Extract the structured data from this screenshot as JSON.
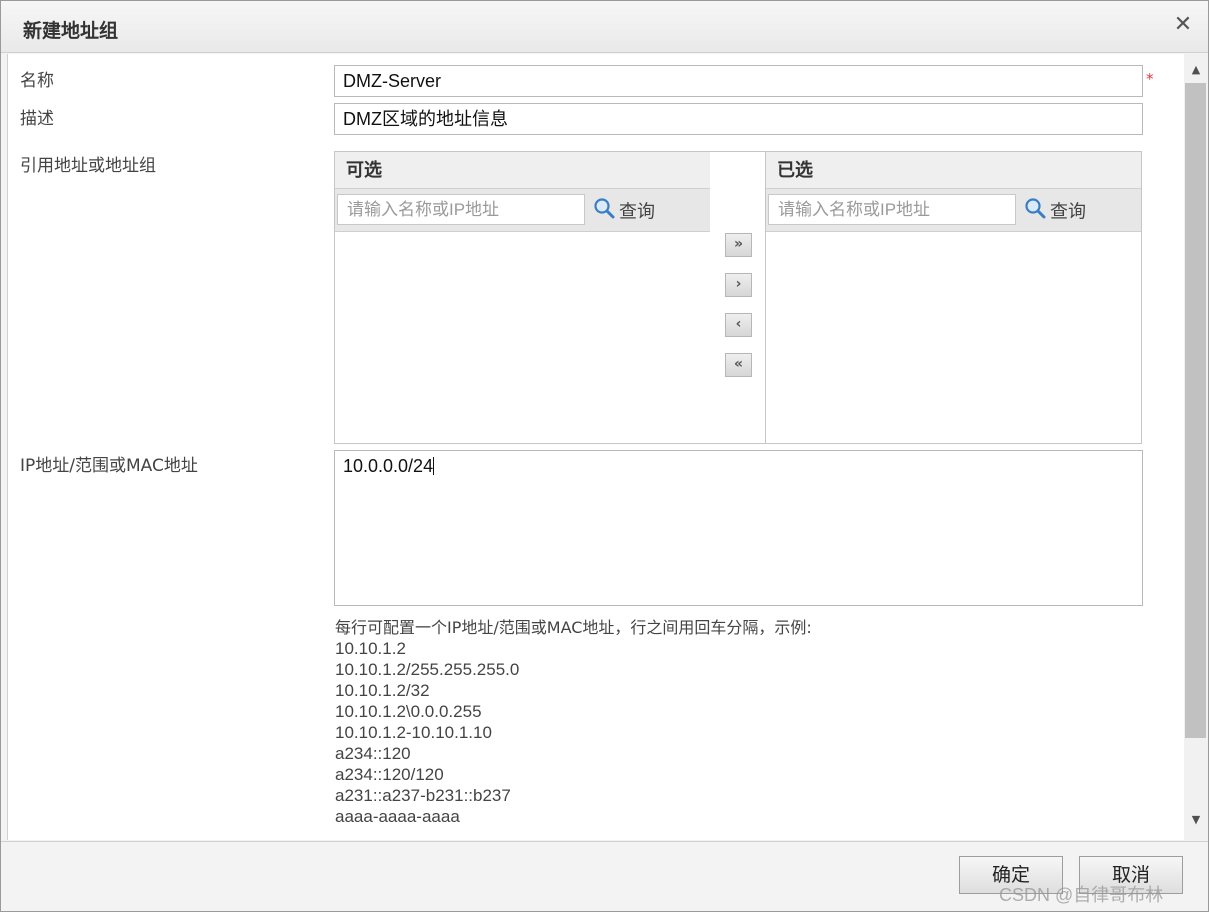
{
  "dialog": {
    "title": "新建地址组",
    "close_icon": "close-icon"
  },
  "form": {
    "name_label": "名称",
    "name_value": "DMZ-Server",
    "required_mark": "*",
    "desc_label": "描述",
    "desc_value": "DMZ区域的地址信息",
    "ref_label": "引用地址或地址组",
    "ip_label": "IP地址/范围或MAC地址",
    "ip_value": "10.0.0.0/24"
  },
  "available": {
    "header": "可选",
    "search_placeholder": "请输入名称或IP地址",
    "search_button": "查询"
  },
  "selected": {
    "header": "已选",
    "search_placeholder": "请输入名称或IP地址",
    "search_button": "查询"
  },
  "transfer": {
    "add_all": "»",
    "add": "›",
    "remove": "‹",
    "remove_all": "«"
  },
  "help": {
    "hint": "每行可配置一个IP地址/范围或MAC地址，行之间用回车分隔，示例:",
    "examples": [
      "10.10.1.2",
      "10.10.1.2/255.255.255.0",
      "10.10.1.2/32",
      "10.10.1.2\\0.0.0.255",
      "10.10.1.2-10.10.1.10",
      "a234::120",
      "a234::120/120",
      "a231::a237-b231::b237",
      "aaaa-aaaa-aaaa"
    ]
  },
  "footer": {
    "ok_label": "确定",
    "cancel_label": "取消"
  },
  "watermark": "CSDN @自律哥布林"
}
